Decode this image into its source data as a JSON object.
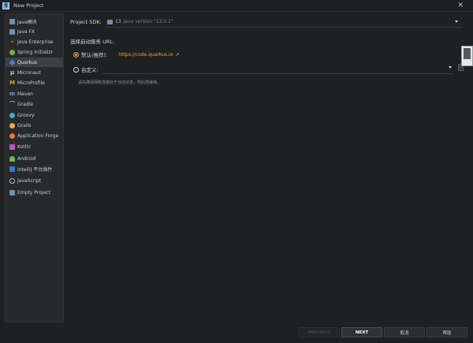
{
  "window": {
    "title": "New Project",
    "logo_text": "IJ",
    "close_glyph": "✕"
  },
  "sidebar": {
    "items": [
      {
        "label": "Java模块",
        "icon": "folder-icon"
      },
      {
        "label": "Java FX",
        "icon": "folder-icon"
      },
      {
        "label": "Java Enterprise",
        "icon": "java-icon"
      },
      {
        "label": "Spring Initializr",
        "icon": "spring-icon"
      },
      {
        "label": "Quarkus",
        "icon": "quarkus-icon",
        "selected": true
      },
      {
        "label": "Micronaut",
        "icon": "micronaut-icon"
      },
      {
        "label": "MicroProfile",
        "icon": "microprofile-icon"
      },
      {
        "label": "Maven",
        "icon": "maven-icon"
      },
      {
        "label": "Gradle",
        "icon": "gradle-icon"
      },
      {
        "label": "Groovy",
        "icon": "groovy-icon"
      },
      {
        "label": "Grails",
        "icon": "grails-icon"
      },
      {
        "label": "Application Forge",
        "icon": "forge-icon"
      },
      {
        "label": "Kotlin",
        "icon": "kotlin-icon"
      },
      {
        "label": "Android",
        "icon": "android-icon"
      },
      {
        "label": "IntelliJ 平台插件",
        "icon": "intellij-icon"
      },
      {
        "label": "JavaScript",
        "icon": "javascript-icon"
      },
      {
        "label": "Empty Project",
        "icon": "folder-icon"
      }
    ]
  },
  "sdk": {
    "label": "Project SDK:",
    "name": "13",
    "version": "java version \"13.0.1\""
  },
  "server_url": {
    "heading": "选择启动服务 URL:",
    "default_label": "默认(推荐):",
    "default_url": "https://code.quarkus.io",
    "external_glyph": "↗",
    "custom_label": "自定义:",
    "custom_value": "",
    "hint": "请先确保网络连接处于活动状态，然后再继续。"
  },
  "buttons": {
    "previous": "PREVIOUS",
    "next": "NEXT",
    "cancel": "取消",
    "help": "帮助"
  },
  "colors": {
    "accent": "#e8a23e",
    "background": "#1f2021",
    "sidebar": "#28292b",
    "selected": "#3e4043"
  }
}
